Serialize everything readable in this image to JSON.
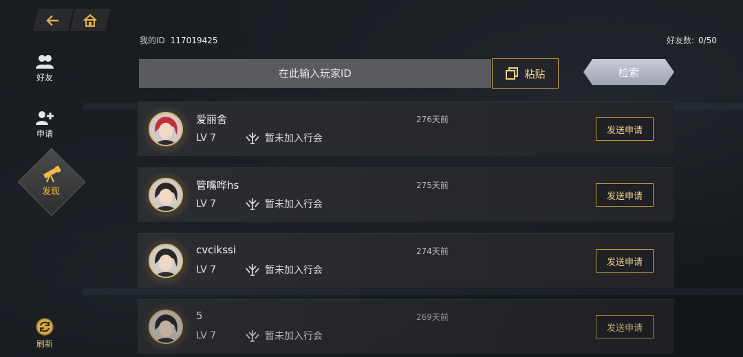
{
  "nav": {
    "back_icon": "back-arrow-icon",
    "home_icon": "home-icon"
  },
  "sidebar": {
    "items": [
      {
        "label": "好友",
        "icon": "friends-icon"
      },
      {
        "label": "申请",
        "icon": "add-user-icon"
      },
      {
        "label": "发现",
        "icon": "telescope-icon",
        "active": true
      },
      {
        "label": "刷新",
        "icon": "refresh-icon"
      }
    ]
  },
  "header": {
    "my_id_label": "我的ID",
    "my_id_value": "117019425",
    "friend_count_label": "好友数:",
    "friend_count_value": "0/50"
  },
  "search": {
    "placeholder": "在此输入玩家ID",
    "paste_label": "粘贴",
    "search_label": "检索"
  },
  "players": [
    {
      "name": "爱丽舍",
      "level": "LV 7",
      "guild": "暂未加入行会",
      "last_online": "276天前",
      "action": "发送申请"
    },
    {
      "name": "管嘴哗hs",
      "level": "LV 7",
      "guild": "暂未加入行会",
      "last_online": "275天前",
      "action": "发送申请"
    },
    {
      "name": "cvcikssi",
      "level": "LV 7",
      "guild": "暂未加入行会",
      "last_online": "274天前",
      "action": "发送申请"
    },
    {
      "name": "5",
      "level": "LV 7",
      "guild": "暂未加入行会",
      "last_online": "269天前",
      "action": "发送申请"
    }
  ],
  "colors": {
    "accent_gold": "#c79c45",
    "active_text": "#f1b84a"
  }
}
